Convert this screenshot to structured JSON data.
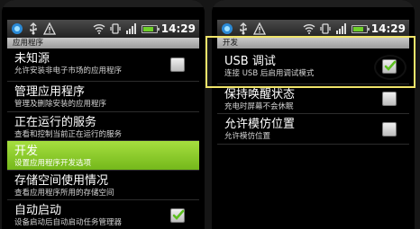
{
  "status_bar": {
    "time": "14:29"
  },
  "left_screen": {
    "header": "应用程序",
    "items": [
      {
        "title": "未知源",
        "subtitle": "允许安装非电子市场的应用程序",
        "checkbox": true,
        "checked": false
      },
      {
        "title": "管理应用程序",
        "subtitle": "管理及删除安装的应用程序"
      },
      {
        "title": "正在运行的服务",
        "subtitle": "查看和控制当前正在运行的服务"
      },
      {
        "title": "开发",
        "subtitle": "设置应用程序开发选项",
        "highlighted": true
      },
      {
        "title": "存储空间使用情况",
        "subtitle": "查看应用程序所用的存储空间"
      },
      {
        "title": "自动启动",
        "subtitle": "设备启动后自动启动任务管理器",
        "checkbox": true,
        "checked": true
      }
    ]
  },
  "right_screen": {
    "header": "开发",
    "items": [
      {
        "title": "USB 调试",
        "subtitle": "连接 USB 后启用调试模式",
        "checkbox": true,
        "checked": true
      },
      {
        "title": "保持唤醒状态",
        "subtitle": "充电时屏幕不会休眠",
        "checkbox": true,
        "checked": false
      },
      {
        "title": "允许模仿位置",
        "subtitle": "允许模仿位置",
        "checkbox": true,
        "checked": false
      }
    ]
  },
  "colors": {
    "highlight": "#8ccf2c",
    "annotation_box": "#f0e46a",
    "check_mark": "#5cbf1f"
  }
}
